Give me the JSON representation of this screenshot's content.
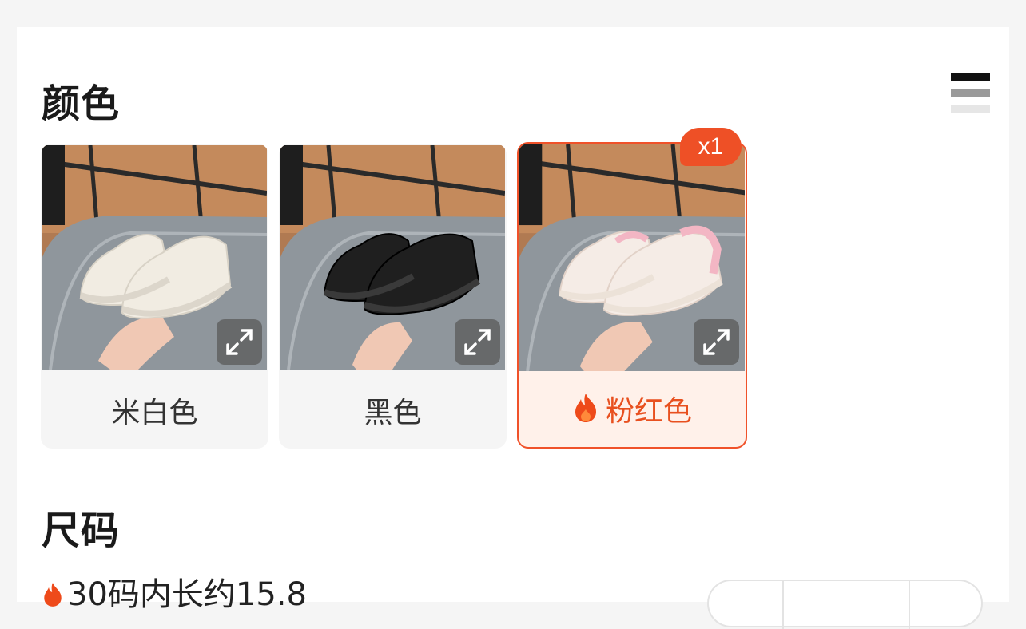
{
  "sections": {
    "color_title": "颜色",
    "size_title": "尺码"
  },
  "colors": [
    {
      "label": "米白色",
      "shoe_color": "#f1ece2",
      "accent": "#dcd6cb",
      "selected": false,
      "hot": false
    },
    {
      "label": "黑色",
      "shoe_color": "#1f1f1f",
      "accent": "#3a3a3a",
      "selected": false,
      "hot": false
    },
    {
      "label": "粉红色",
      "shoe_color": "#f5ece6",
      "accent": "#f3b6c4",
      "selected": true,
      "hot": true
    }
  ],
  "selected_badge": "x1",
  "size_row": {
    "text": "30码内长约15.8"
  },
  "theme": {
    "accent": "#ee5026",
    "selected_bg": "#fff1ea"
  },
  "icons": [
    "list-view-icon",
    "expand-icon",
    "fire-icon"
  ]
}
